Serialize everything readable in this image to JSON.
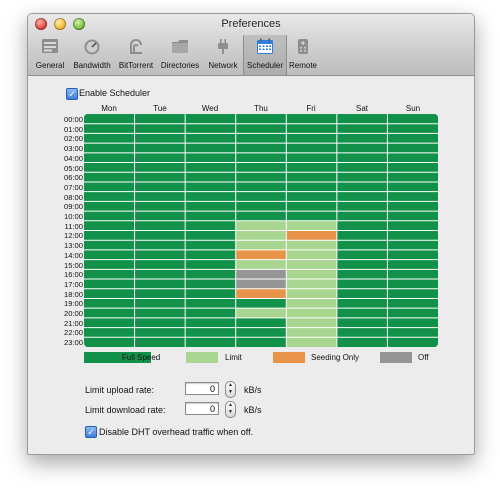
{
  "window": {
    "title": "Preferences"
  },
  "toolbar": {
    "items": [
      {
        "label": "General",
        "icon": "general-icon"
      },
      {
        "label": "Bandwidth",
        "icon": "bandwidth-icon"
      },
      {
        "label": "BitTorrent",
        "icon": "bittorrent-icon"
      },
      {
        "label": "Directories",
        "icon": "folder-icon"
      },
      {
        "label": "Network",
        "icon": "network-plug-icon"
      },
      {
        "label": "Scheduler",
        "icon": "calendar-icon",
        "selected": true
      },
      {
        "label": "Remote",
        "icon": "remote-icon"
      }
    ]
  },
  "scheduler": {
    "enable_label": "Enable Scheduler",
    "enabled": true,
    "days": [
      "Mon",
      "Tue",
      "Wed",
      "Thu",
      "Fri",
      "Sat",
      "Sun"
    ],
    "hours": [
      "00:00",
      "01:00",
      "02:00",
      "03:00",
      "04:00",
      "05:00",
      "06:00",
      "07:00",
      "08:00",
      "09:00",
      "10:00",
      "11:00",
      "12:00",
      "13:00",
      "14:00",
      "15:00",
      "16:00",
      "17:00",
      "18:00",
      "19:00",
      "20:00",
      "21:00",
      "22:00",
      "23:00"
    ],
    "colors": {
      "full": "#11914a",
      "limit": "#a8d590",
      "seeding": "#e8934a",
      "off": "#959595"
    },
    "grid": [
      [
        "F",
        "F",
        "F",
        "F",
        "F",
        "F",
        "F",
        "F",
        "F",
        "F",
        "F",
        "F",
        "F",
        "F",
        "F",
        "F",
        "F",
        "F",
        "F",
        "F",
        "F",
        "F",
        "F",
        "F"
      ],
      [
        "F",
        "F",
        "F",
        "F",
        "F",
        "F",
        "F",
        "F",
        "F",
        "F",
        "F",
        "F",
        "F",
        "F",
        "F",
        "F",
        "F",
        "F",
        "F",
        "F",
        "F",
        "F",
        "F",
        "F"
      ],
      [
        "F",
        "F",
        "F",
        "F",
        "F",
        "F",
        "F",
        "F",
        "F",
        "F",
        "F",
        "F",
        "F",
        "F",
        "F",
        "F",
        "F",
        "F",
        "F",
        "F",
        "F",
        "F",
        "F",
        "F"
      ],
      [
        "F",
        "F",
        "F",
        "F",
        "F",
        "F",
        "F",
        "F",
        "F",
        "F",
        "F",
        "L",
        "L",
        "L",
        "S",
        "L",
        "O",
        "O",
        "S",
        "F",
        "L",
        "F",
        "F",
        "F"
      ],
      [
        "F",
        "F",
        "F",
        "F",
        "F",
        "F",
        "F",
        "F",
        "F",
        "F",
        "F",
        "L",
        "S",
        "L",
        "L",
        "L",
        "L",
        "L",
        "L",
        "L",
        "L",
        "L",
        "L",
        "L"
      ],
      [
        "F",
        "F",
        "F",
        "F",
        "F",
        "F",
        "F",
        "F",
        "F",
        "F",
        "F",
        "F",
        "F",
        "F",
        "F",
        "F",
        "F",
        "F",
        "F",
        "F",
        "F",
        "F",
        "F",
        "F"
      ],
      [
        "F",
        "F",
        "F",
        "F",
        "F",
        "F",
        "F",
        "F",
        "F",
        "F",
        "F",
        "F",
        "F",
        "F",
        "F",
        "F",
        "F",
        "F",
        "F",
        "F",
        "F",
        "F",
        "F",
        "F"
      ]
    ],
    "legend": [
      {
        "key": "full",
        "label": "Full Speed"
      },
      {
        "key": "limit",
        "label": "Limit"
      },
      {
        "key": "seeding",
        "label": "Seeding Only"
      },
      {
        "key": "off",
        "label": "Off"
      }
    ],
    "upload": {
      "label": "Limit upload rate:",
      "value": "0",
      "unit": "kB/s"
    },
    "download": {
      "label": "Limit download rate:",
      "value": "0",
      "unit": "kB/s"
    },
    "dht_label": "Disable DHT overhead traffic when off.",
    "dht_checked": true
  }
}
